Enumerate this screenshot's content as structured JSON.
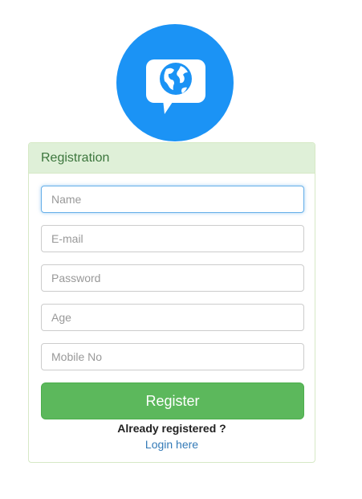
{
  "logo": {
    "icon": "chat-globe-icon",
    "color": "#1b93f5"
  },
  "panel": {
    "title": "Registration",
    "fields": {
      "name": {
        "placeholder": "Name",
        "value": ""
      },
      "email": {
        "placeholder": "E-mail",
        "value": ""
      },
      "password": {
        "placeholder": "Password",
        "value": ""
      },
      "age": {
        "placeholder": "Age",
        "value": ""
      },
      "mobile": {
        "placeholder": "Mobile No",
        "value": ""
      }
    },
    "register_label": "Register",
    "already_text": "Already registered ?",
    "login_link": "Login here"
  },
  "colors": {
    "heading_bg": "#dff0d8",
    "heading_text": "#3c763d",
    "button_bg": "#5cb85c",
    "link": "#337ab7"
  }
}
